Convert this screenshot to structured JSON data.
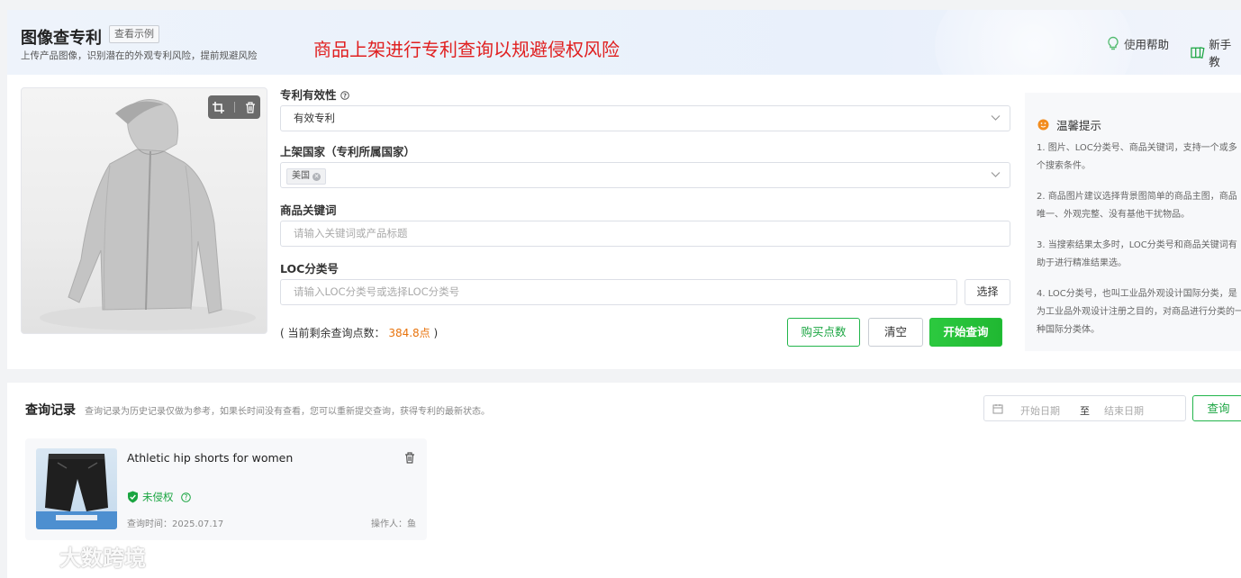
{
  "header": {
    "title": "图像查专利",
    "example_label": "查看示例",
    "subtitle": "上传产品图像，识别潜在的外观专利风险，提前规避风险",
    "banner": "商品上架进行专利查询以规避侵权风险",
    "help_label": "使用帮助",
    "guide_label": "新手教"
  },
  "form": {
    "validity_label": "专利有效性",
    "validity_value": "有效专利",
    "country_label": "上架国家（专利所属国家）",
    "country_tag": "美国",
    "keyword_label": "商品关键词",
    "keyword_placeholder": "请输入关键词或产品标题",
    "loc_label": "LOC分类号",
    "loc_placeholder": "请输入LOC分类号或选择LOC分类号",
    "select_label": "选择",
    "points_prefix": "( 当前剩余查询点数：",
    "points_value": "384.8点",
    "points_suffix": ")",
    "buy_label": "购买点数",
    "clear_label": "清空",
    "start_label": "开始查询"
  },
  "tips": {
    "title": "温馨提示",
    "items": [
      "1. 图片、LOC分类号、商品关键词，支持一个或多个搜索条件。",
      "2. 商品图片建议选择背景图简单的商品主图，商品唯一、外观完整、没有基他干扰物品。",
      "3. 当搜索结果太多时，LOC分类号和商品关键词有助于进行精准结果选。",
      "4. LOC分类号，也叫工业品外观设计国际分类，是为工业品外观设计注册之目的，对商品进行分类的一种国际分类体。"
    ]
  },
  "history": {
    "title": "查询记录",
    "note": "查询记录为历史记录仅做为参考，如果长时间没有查看，您可以重新提交查询，获得专利的最新状态。",
    "start_date_placeholder": "开始日期",
    "to_label": "至",
    "end_date_placeholder": "结束日期",
    "query_label": "查询",
    "records": [
      {
        "name": "Athletic hip shorts for women",
        "status": "未侵权",
        "time": "查询时间：2025.07.17",
        "operator": "操作人：鱼"
      }
    ]
  },
  "watermark": "大数跨境",
  "colors": {
    "accent": "#1aa541",
    "banner": "#e02020",
    "points": "#e8730c"
  }
}
